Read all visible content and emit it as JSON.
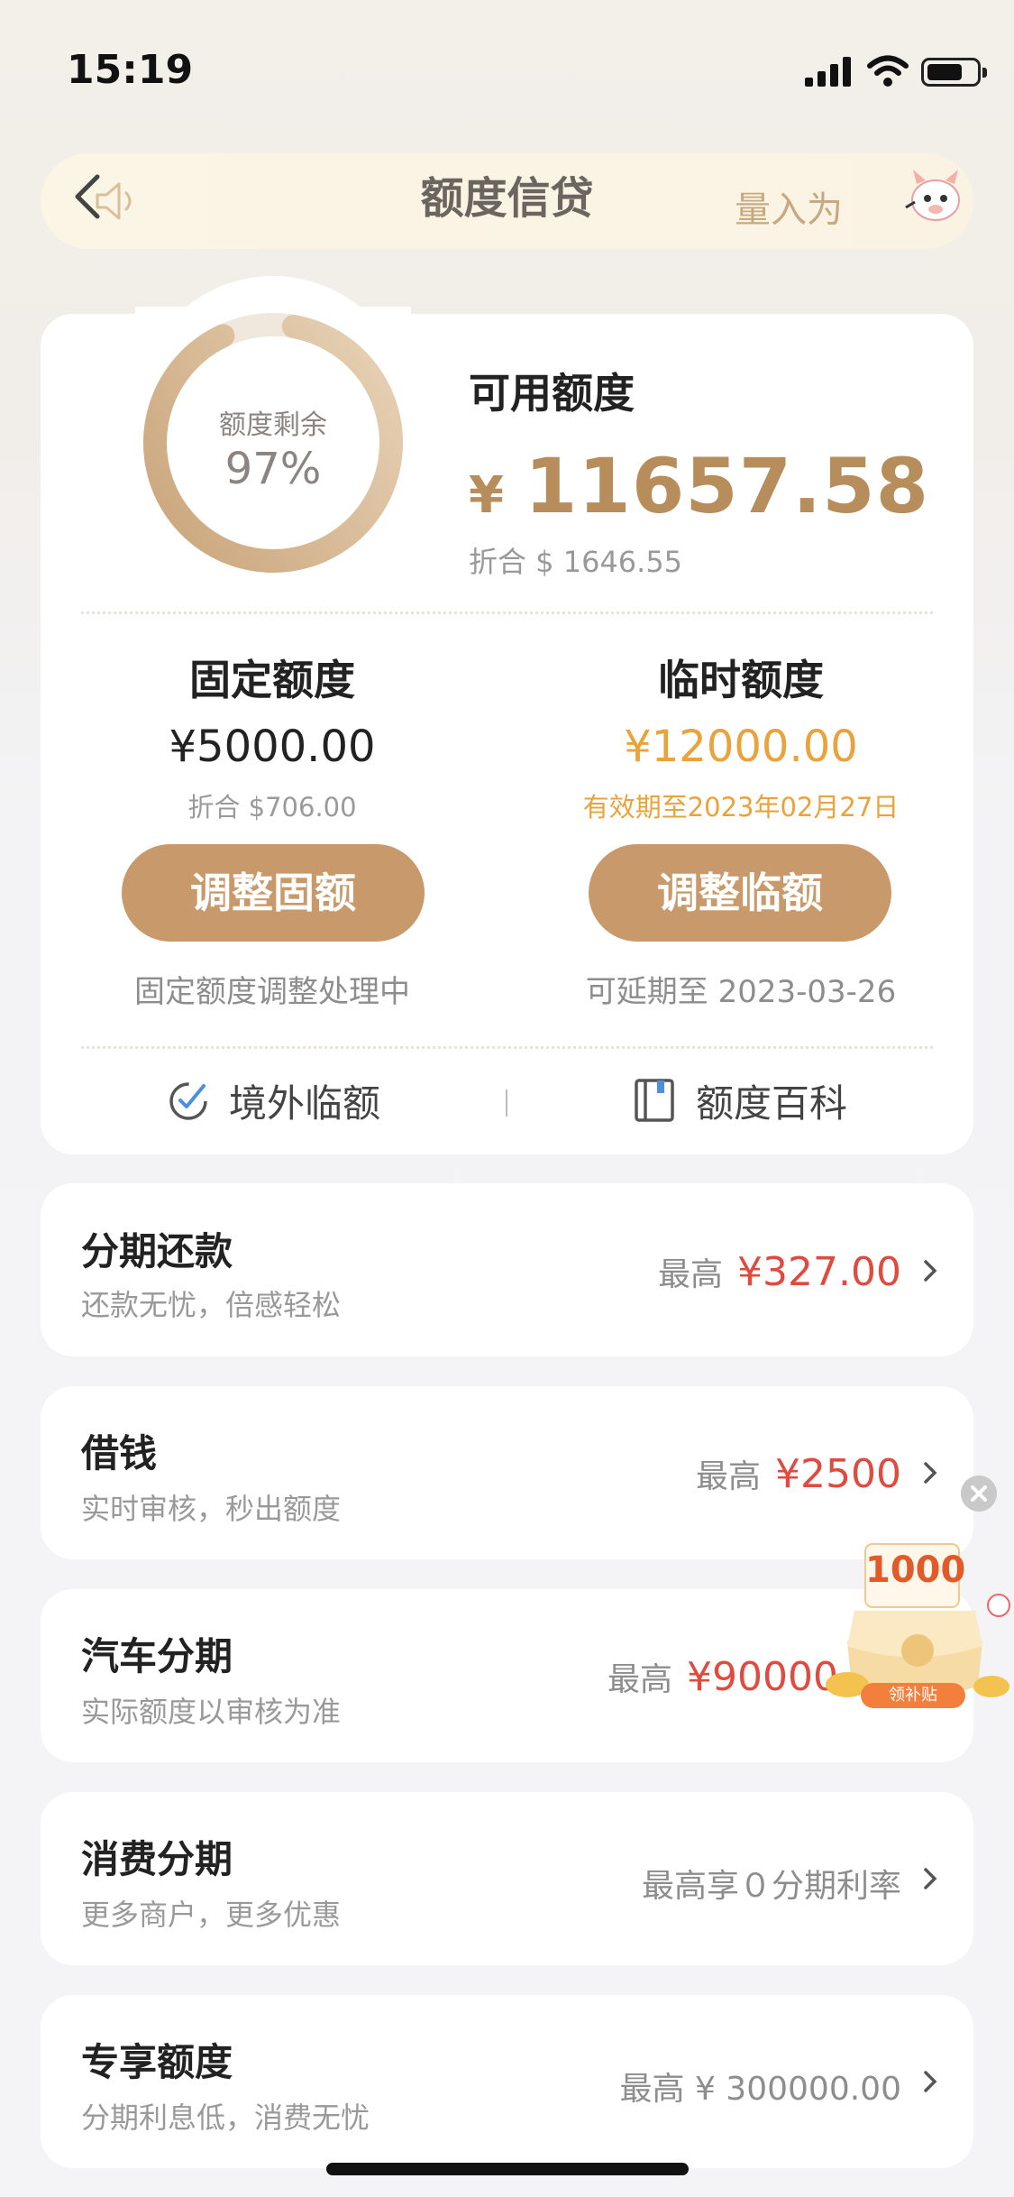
{
  "status_bar": {
    "time": "15:19"
  },
  "nav": {
    "title": "额度信贷",
    "marquee_text": "量入为"
  },
  "summary": {
    "ring_label": "额度剩余",
    "ring_percent": "97%",
    "ring_fraction": 0.97,
    "available_label": "可用额度",
    "available_currency": "¥",
    "available_amount": "11657.58",
    "available_usd": "折合 $ 1646.55"
  },
  "fixed": {
    "title": "固定额度",
    "amount": "¥5000.00",
    "sub": "折合 $706.00",
    "button": "调整固额",
    "note": "固定额度调整处理中"
  },
  "temp": {
    "title": "临时额度",
    "amount": "¥12000.00",
    "sub": "有效期至2023年02月27日",
    "button": "调整临额",
    "note": "可延期至 2023-03-26"
  },
  "links": {
    "overseas": "境外临额",
    "encyclopedia": "额度百科"
  },
  "list": [
    {
      "title": "分期还款",
      "sub": "还款无忧，倍感轻松",
      "prefix": "最高",
      "amount": "¥327.00"
    },
    {
      "title": "借钱",
      "sub": "实时审核，秒出额度",
      "prefix": "最高",
      "amount": "¥2500"
    },
    {
      "title": "汽车分期",
      "sub": "实际额度以审核为准",
      "prefix": "最高",
      "amount": "¥90000.00"
    },
    {
      "title": "消费分期",
      "sub": "更多商户，更多优惠",
      "prefix": "最高享０分期利率",
      "amount": ""
    },
    {
      "title": "专享额度",
      "sub": "分期利息低，消费无忧",
      "prefix": "最高 ¥ 300000.00",
      "amount": ""
    }
  ],
  "promo": {
    "number": "1000",
    "tag": "领补贴"
  },
  "colors": {
    "gold": "#c8996a",
    "orange": "#e9a33a",
    "red": "#e04a3f"
  }
}
